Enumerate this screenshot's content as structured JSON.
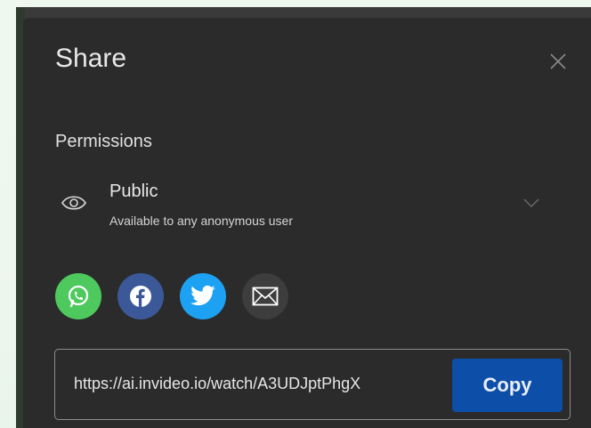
{
  "dialog": {
    "title": "Share",
    "close_icon": "close-icon"
  },
  "permissions": {
    "heading": "Permissions",
    "selected": {
      "icon": "eye-icon",
      "title": "Public",
      "subtitle": "Available to any anonymous user"
    },
    "dropdown_icon": "chevron-down-icon"
  },
  "social": [
    {
      "name": "whatsapp",
      "icon": "whatsapp-icon",
      "color": "#4ec95e"
    },
    {
      "name": "facebook",
      "icon": "facebook-icon",
      "color": "#3b5998"
    },
    {
      "name": "twitter",
      "icon": "twitter-icon",
      "color": "#1da1f2"
    },
    {
      "name": "email",
      "icon": "mail-icon",
      "color": "#3d3d3d"
    }
  ],
  "link": {
    "url": "https://ai.invideo.io/watch/A3UDJptPhgX",
    "copy_label": "Copy"
  },
  "colors": {
    "dialog_bg": "#2b2b2b",
    "copy_button": "#0d4ea8"
  }
}
